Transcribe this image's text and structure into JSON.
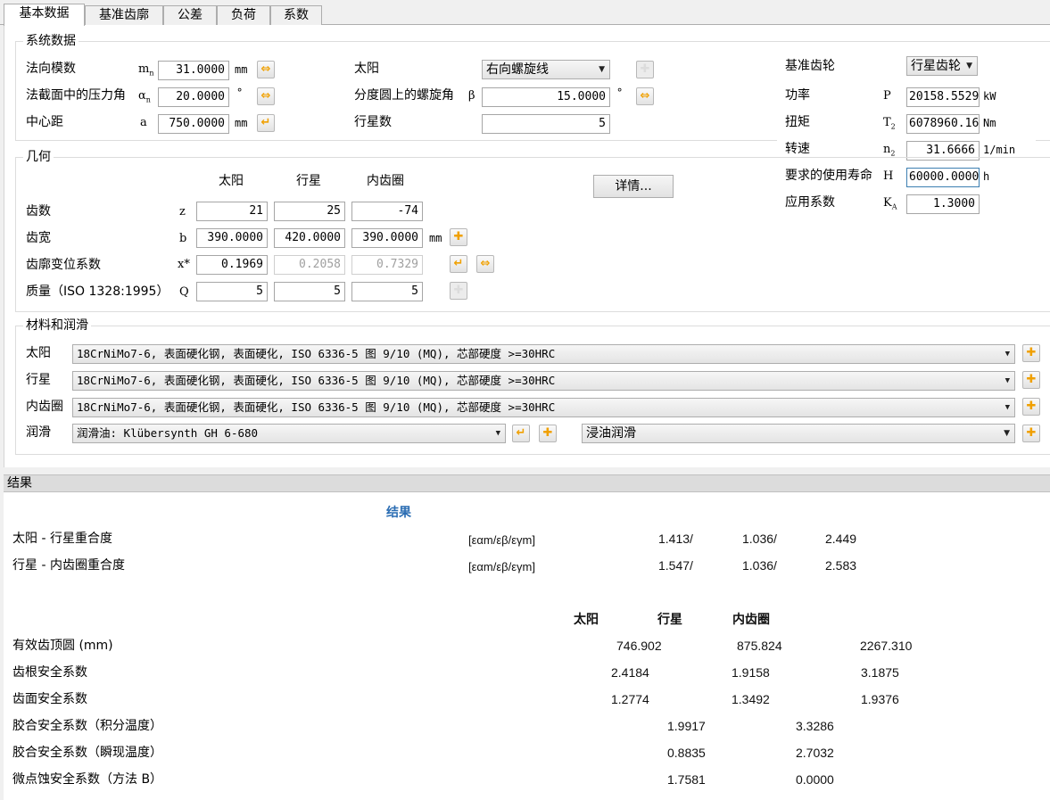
{
  "tabs": [
    {
      "label": "基本数据"
    },
    {
      "label": "基准齿廓"
    },
    {
      "label": "公差"
    },
    {
      "label": "负荷"
    },
    {
      "label": "系数"
    }
  ],
  "system": {
    "title": "系统数据",
    "normal_module": {
      "label": "法向模数",
      "symbol": "m",
      "sub": "n",
      "value": "31.0000",
      "unit": "mm"
    },
    "pressure_angle": {
      "label": "法截面中的压力角",
      "symbol": "α",
      "sub": "n",
      "value": "20.0000",
      "unit": "°"
    },
    "center_distance": {
      "label": "中心距",
      "symbol": "a",
      "value": "750.0000",
      "unit": "mm"
    },
    "sun": {
      "label": "太阳",
      "value": "右向螺旋线"
    },
    "helix_angle": {
      "label": "分度圆上的螺旋角",
      "symbol": "β",
      "value": "15.0000",
      "unit": "°"
    },
    "planets": {
      "label": "行星数",
      "value": "5"
    }
  },
  "right": {
    "ref_gear": {
      "label": "基准齿轮",
      "value": "行星齿轮"
    },
    "power": {
      "label": "功率",
      "symbol": "P",
      "value": "20158.5529",
      "unit": "kW"
    },
    "torque": {
      "label": "扭矩",
      "symbol": "T",
      "sub": "2",
      "value": "6078960.16",
      "unit": "Nm"
    },
    "speed": {
      "label": "转速",
      "symbol": "n",
      "sub": "2",
      "value": "31.6666",
      "unit": "1/min"
    },
    "life": {
      "label": "要求的使用寿命",
      "symbol": "H",
      "value": "60000.0000",
      "unit": "h"
    },
    "app_factor": {
      "label": "应用系数",
      "symbol": "K",
      "sub": "A",
      "value": "1.3000"
    }
  },
  "geometry": {
    "title": "几何",
    "columns": [
      "太阳",
      "行星",
      "内齿圈"
    ],
    "details_button": "详情...",
    "teeth": {
      "label": "齿数",
      "symbol": "z",
      "values": [
        "21",
        "25",
        "-74"
      ]
    },
    "width": {
      "label": "齿宽",
      "symbol": "b",
      "values": [
        "390.0000",
        "420.0000",
        "390.0000"
      ],
      "unit": "mm"
    },
    "shift": {
      "label": "齿廓变位系数",
      "symbol": "x*",
      "values": [
        "0.1969",
        "0.2058",
        "0.7329"
      ]
    },
    "quality": {
      "label": "质量（ISO 1328:1995）",
      "symbol": "Q",
      "values": [
        "5",
        "5",
        "5"
      ]
    }
  },
  "materials": {
    "title": "材料和润滑",
    "sun": {
      "label": "太阳",
      "value": "18CrNiMo7-6, 表面硬化钢, 表面硬化, ISO 6336-5 图 9/10 (MQ), 芯部硬度 >=30HRC"
    },
    "planet": {
      "label": "行星",
      "value": "18CrNiMo7-6, 表面硬化钢, 表面硬化, ISO 6336-5 图 9/10 (MQ), 芯部硬度 >=30HRC"
    },
    "ring": {
      "label": "内齿圈",
      "value": "18CrNiMo7-6, 表面硬化钢, 表面硬化, ISO 6336-5 图 9/10 (MQ), 芯部硬度 >=30HRC"
    },
    "lube": {
      "label": "润滑",
      "value": "润滑油: Klübersynth GH 6-680",
      "method": "浸油润滑"
    }
  },
  "results": {
    "header": "结果",
    "title": "结果",
    "contact_rows": [
      {
        "label": "太阳 - 行星重合度",
        "unit": "[εαm/εβ/εγm]",
        "v1": "1.413/",
        "v2": "1.036/",
        "v3": "2.449"
      },
      {
        "label": "行星 - 内齿圈重合度",
        "unit": "[εαm/εβ/εγm]",
        "v1": "1.547/",
        "v2": "1.036/",
        "v3": "2.583"
      }
    ],
    "columns": [
      "太阳",
      "行星",
      "内齿圈"
    ],
    "tip_circle": {
      "label": "有效齿顶圆 (mm)",
      "values": [
        "746.902",
        "875.824",
        "2267.310"
      ]
    },
    "root_safety": {
      "label": "齿根安全系数",
      "values": [
        "2.4184",
        "1.9158",
        "3.1875"
      ]
    },
    "flank_safety": {
      "label": "齿面安全系数",
      "values": [
        "1.2774",
        "1.3492",
        "1.9376"
      ]
    },
    "scuff_int": {
      "label": "胶合安全系数（积分温度）",
      "values": [
        "1.9917",
        "3.3286"
      ]
    },
    "scuff_flash": {
      "label": "胶合安全系数（瞬现温度）",
      "values": [
        "0.8835",
        "2.7032"
      ]
    },
    "micropitting": {
      "label": "微点蚀安全系数（方法 B）",
      "values": [
        "1.7581",
        "0.0000"
      ]
    }
  }
}
